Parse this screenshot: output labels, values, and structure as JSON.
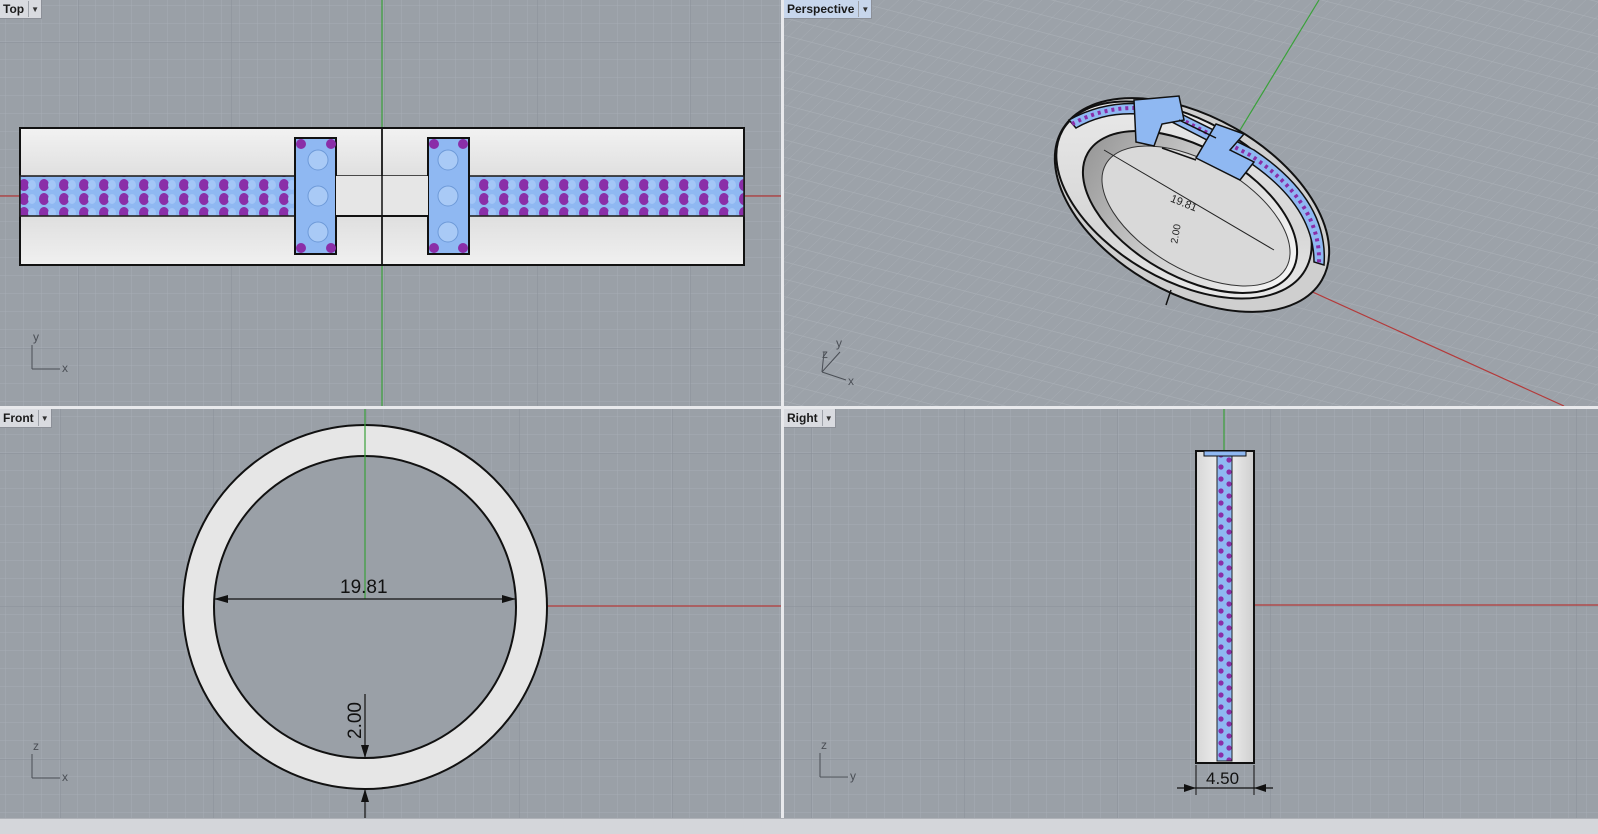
{
  "viewports": [
    {
      "name": "Top",
      "active": false,
      "axes": [
        "y",
        "x"
      ]
    },
    {
      "name": "Perspective",
      "active": true,
      "axes": [
        "z",
        "y",
        "x"
      ]
    },
    {
      "name": "Front",
      "active": false,
      "axes": [
        "z",
        "x"
      ]
    },
    {
      "name": "Right",
      "active": false,
      "axes": [
        "z",
        "y"
      ]
    }
  ],
  "dimensions": {
    "inner_diameter": "19.81",
    "thickness": "2.00",
    "width": "4.50"
  },
  "colors": {
    "grid_background": "#9aa0a7",
    "grid_minor": "#a6acb3",
    "grid_major": "#8d939b",
    "x_axis": "#b43a3a",
    "y_axis": "#3aa13a",
    "metal": "#e4e4e4",
    "stone_blue": "#8fb8f2",
    "stone_purple": "#8a2ea8"
  },
  "dropdown_icon": "chevron-down-icon"
}
